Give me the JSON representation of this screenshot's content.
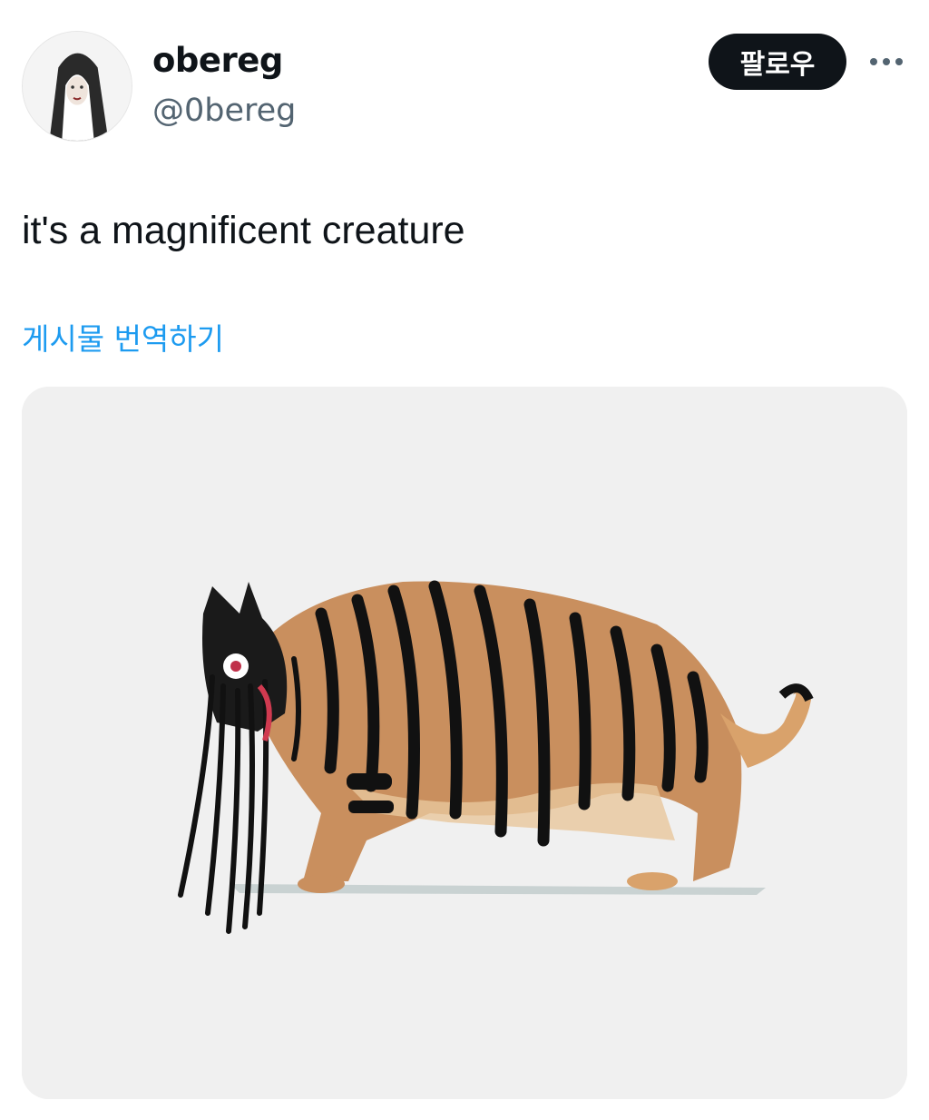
{
  "tweet": {
    "author": {
      "display_name": "obereg",
      "handle": "@0bereg"
    },
    "follow_label": "팔로우",
    "more_icon": "more-horizontal-icon",
    "text": "it's a magnificent creature",
    "translate_label": "게시물 번역하기",
    "media_description_icon": "tiger-creature-drawing"
  },
  "colors": {
    "text_primary": "#0f1419",
    "text_secondary": "#536471",
    "link": "#1d9bf0",
    "button_bg": "#0f1419"
  }
}
